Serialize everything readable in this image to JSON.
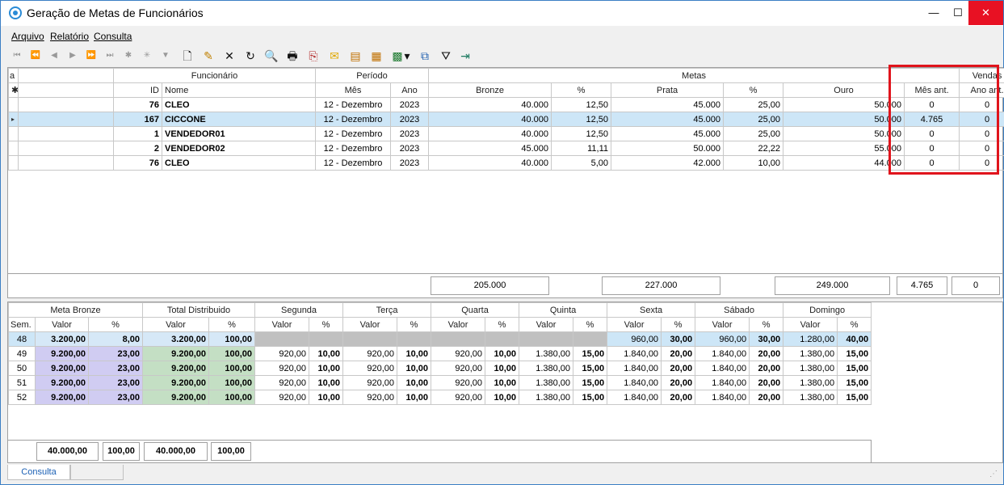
{
  "window": {
    "title": "Geração de Metas de Funcionários",
    "min_label": "—",
    "max_label": "☐",
    "close_label": "✕"
  },
  "menu": [
    "Arquivo",
    "Relatório",
    "Consulta"
  ],
  "toolbar": {
    "nav": [
      "⏮",
      "⏪",
      "◀",
      "▶",
      "⏩",
      "⏭",
      "✱",
      "✳",
      "▼"
    ],
    "actions": [
      "🗋",
      "✎",
      "✕",
      "↻",
      "🔍",
      "🖶",
      "⎘",
      "✉",
      "▤",
      "▦",
      "▩",
      "▾",
      "⧉",
      "⛛",
      "⇥"
    ]
  },
  "top_grid": {
    "group_headers": {
      "corner": "a",
      "funcionario": "Funcionário",
      "periodo": "Período",
      "metas": "Metas",
      "vendas": "Vendas"
    },
    "col_headers": {
      "id": "ID",
      "nome": "Nome",
      "mes": "Mês",
      "ano": "Ano",
      "bronze": "Bronze",
      "pct1": "%",
      "prata": "Prata",
      "pct2": "%",
      "ouro": "Ouro",
      "mes_ant": "Mês ant.",
      "ano_ant": "Ano ant."
    },
    "rows": [
      {
        "id": "76",
        "nome": "CLEO",
        "mes": "12 - Dezembro",
        "ano": "2023",
        "bronze": "40.000",
        "pct1": "12,50",
        "prata": "45.000",
        "pct2": "25,00",
        "ouro": "50.000",
        "mes_ant": "0",
        "ano_ant": "0"
      },
      {
        "id": "167",
        "nome": "CICCONE",
        "mes": "12 - Dezembro",
        "ano": "2023",
        "bronze": "40.000",
        "pct1": "12,50",
        "prata": "45.000",
        "pct2": "25,00",
        "ouro": "50.000",
        "mes_ant": "4.765",
        "ano_ant": "0"
      },
      {
        "id": "1",
        "nome": "VENDEDOR01",
        "mes": "12 - Dezembro",
        "ano": "2023",
        "bronze": "40.000",
        "pct1": "12,50",
        "prata": "45.000",
        "pct2": "25,00",
        "ouro": "50.000",
        "mes_ant": "0",
        "ano_ant": "0"
      },
      {
        "id": "2",
        "nome": "VENDEDOR02",
        "mes": "12 - Dezembro",
        "ano": "2023",
        "bronze": "45.000",
        "pct1": "11,11",
        "prata": "50.000",
        "pct2": "22,22",
        "ouro": "55.000",
        "mes_ant": "0",
        "ano_ant": "0"
      },
      {
        "id": "76",
        "nome": "CLEO",
        "mes": "12 - Dezembro",
        "ano": "2023",
        "bronze": "40.000",
        "pct1": "5,00",
        "prata": "42.000",
        "pct2": "10,00",
        "ouro": "44.000",
        "mes_ant": "0",
        "ano_ant": "0"
      }
    ],
    "totals": {
      "bronze": "205.000",
      "prata": "227.000",
      "ouro": "249.000",
      "mes_ant": "4.765",
      "ano_ant": "0"
    }
  },
  "bottom_grid": {
    "group_headers": [
      "Meta Bronze",
      "Total Distribuido",
      "Segunda",
      "Terça",
      "Quarta",
      "Quinta",
      "Sexta",
      "Sábado",
      "Domingo"
    ],
    "sub": {
      "sem": "Sem.",
      "valor": "Valor",
      "pct": "%"
    },
    "rows": [
      [
        "48",
        "3.200,00",
        "8,00",
        "3.200,00",
        "100,00",
        "",
        "",
        "",
        "",
        "",
        "",
        "",
        "",
        "960,00",
        "30,00",
        "960,00",
        "30,00",
        "1.280,00",
        "40,00"
      ],
      [
        "49",
        "9.200,00",
        "23,00",
        "9.200,00",
        "100,00",
        "920,00",
        "10,00",
        "920,00",
        "10,00",
        "920,00",
        "10,00",
        "1.380,00",
        "15,00",
        "1.840,00",
        "20,00",
        "1.840,00",
        "20,00",
        "1.380,00",
        "15,00"
      ],
      [
        "50",
        "9.200,00",
        "23,00",
        "9.200,00",
        "100,00",
        "920,00",
        "10,00",
        "920,00",
        "10,00",
        "920,00",
        "10,00",
        "1.380,00",
        "15,00",
        "1.840,00",
        "20,00",
        "1.840,00",
        "20,00",
        "1.380,00",
        "15,00"
      ],
      [
        "51",
        "9.200,00",
        "23,00",
        "9.200,00",
        "100,00",
        "920,00",
        "10,00",
        "920,00",
        "10,00",
        "920,00",
        "10,00",
        "1.380,00",
        "15,00",
        "1.840,00",
        "20,00",
        "1.840,00",
        "20,00",
        "1.380,00",
        "15,00"
      ],
      [
        "52",
        "9.200,00",
        "23,00",
        "9.200,00",
        "100,00",
        "920,00",
        "10,00",
        "920,00",
        "10,00",
        "920,00",
        "10,00",
        "1.380,00",
        "15,00",
        "1.840,00",
        "20,00",
        "1.840,00",
        "20,00",
        "1.380,00",
        "15,00"
      ]
    ],
    "totals": [
      "40.000,00",
      "100,00",
      "40.000,00",
      "100,00"
    ]
  },
  "tabs": [
    "Consulta"
  ],
  "colors": {
    "selected_row": "#cde6f7",
    "bronze_pct": "#d0ccf2",
    "distributed": "#c4dfc4",
    "highlight_box": "#e0141c"
  }
}
